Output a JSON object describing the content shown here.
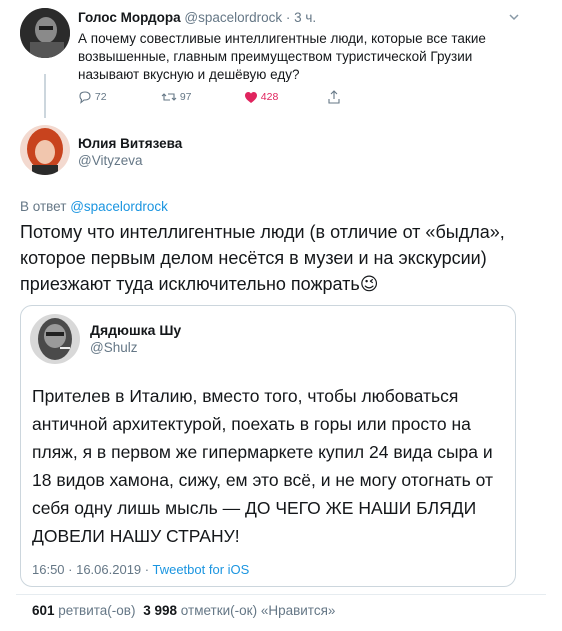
{
  "parent": {
    "name": "Голос Мордора",
    "handle": "@spacelordrock",
    "time": "· 3 ч.",
    "text_lines": [
      "А почему совестливые интеллигентные люди, которые все такие",
      "возвышенные, главным преимуществом туристической Грузии",
      "называют вкусную и дешёвую еду?"
    ],
    "replies": "72",
    "retweets": "97",
    "likes": "428"
  },
  "main": {
    "name": "Юлия Витязева",
    "handle": "@Vityzeva",
    "reply_prefix": "В ответ",
    "reply_to": "@spacelordrock",
    "text_lines": [
      "Потому что интеллигентные люди (в отличие от «быдла»,",
      "которое первым делом несётся в музеи и на экскурсии)",
      "приезжают туда исключительно пожрать"
    ],
    "emoji": "😉"
  },
  "quoted": {
    "name": "Дядюшка Шу",
    "handle": "@Shulz",
    "text_lines": [
      "Прителев в Италию, вместо того, чтобы любоваться",
      "античной архитектурой, поехать в горы или просто на",
      "пляж, я в первом же гипермаркете купил 24 вида сыра и",
      "18 видов хамона, сижу, ем это всё, и не могу отогнать от",
      "себя одну лишь мысль — ДО ЧЕГО ЖЕ НАШИ БЛЯДИ",
      "ДОВЕЛИ НАШУ СТРАНУ!"
    ]
  },
  "meta": {
    "timestamp": "16:50 · 16.06.2019 ·",
    "client": "Tweetbot for iOS"
  },
  "stats": {
    "retweets_count": "601",
    "retweets_label": "ретвита(-ов)",
    "likes_count": "3 998",
    "likes_label": "отметки(-ок) «Нравится»"
  },
  "colors": {
    "accent": "#1b95e0",
    "like": "#e0245e",
    "muted": "#657786"
  }
}
